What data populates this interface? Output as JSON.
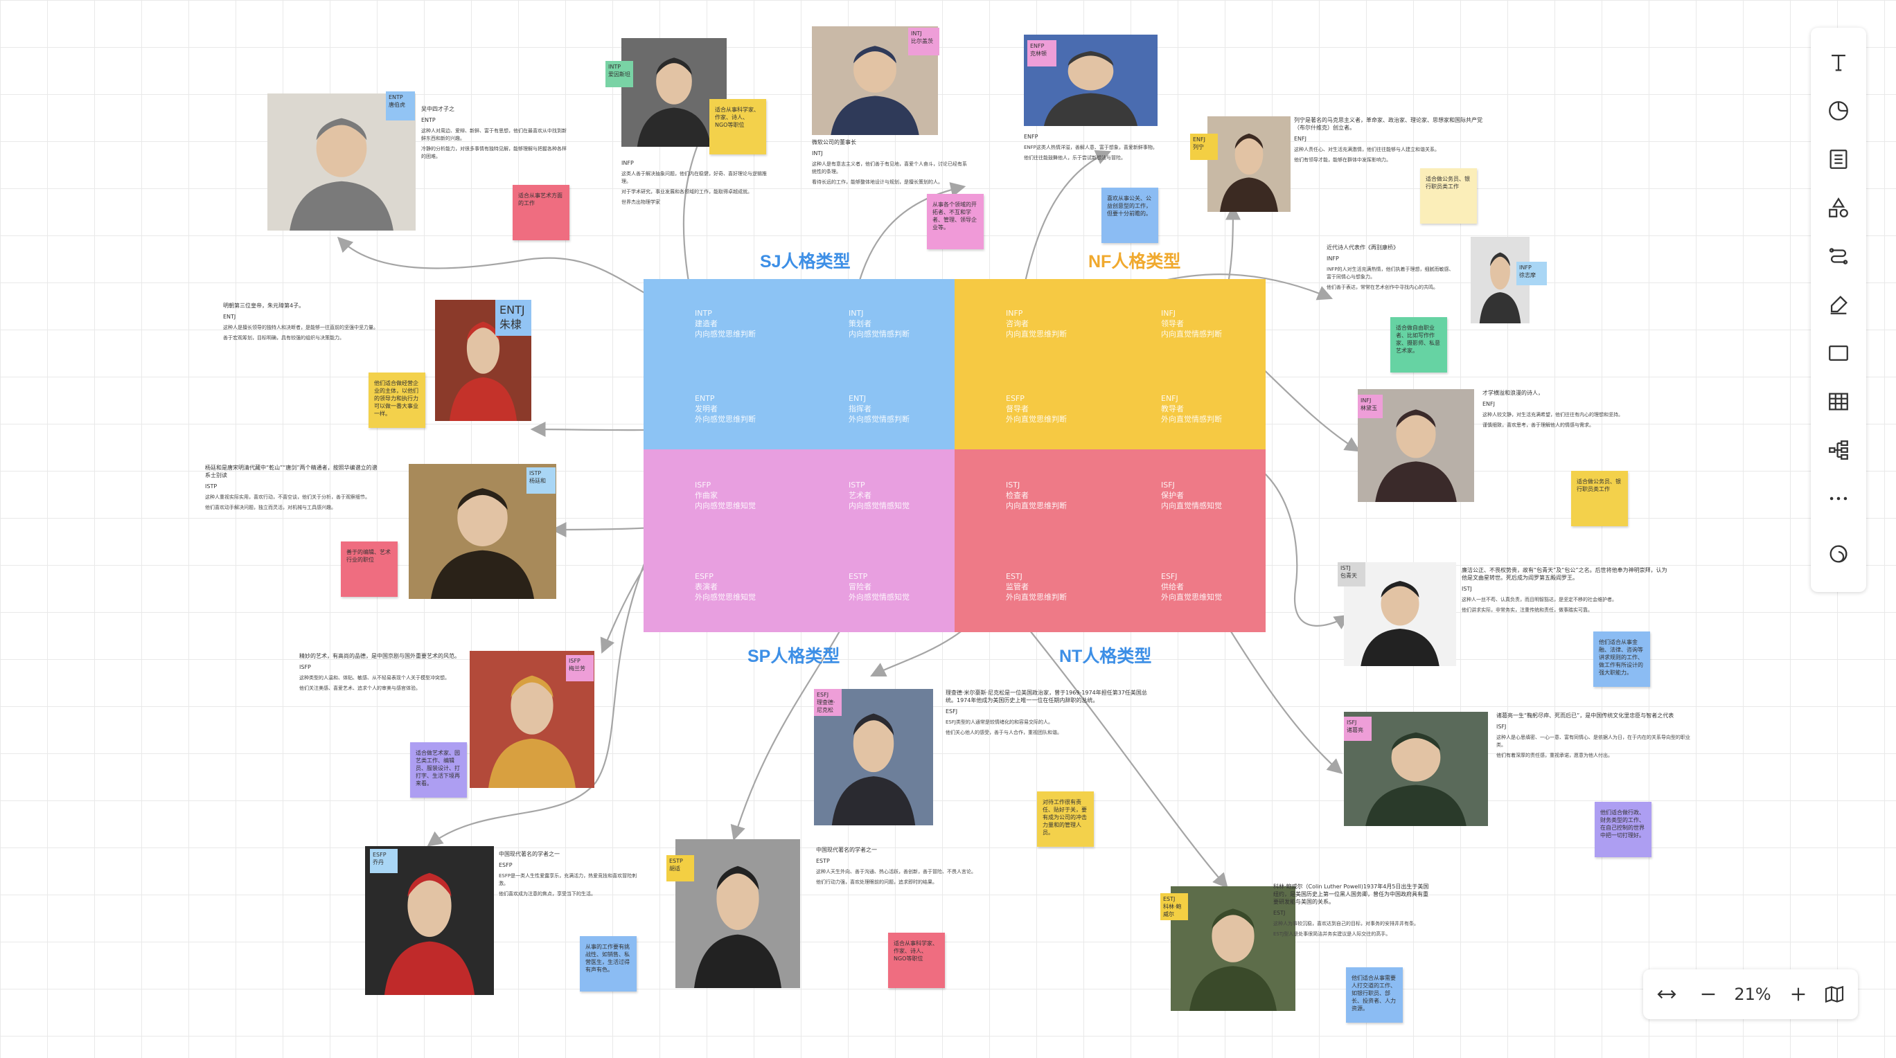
{
  "quadrant_titles": {
    "sj": "SJ人格类型",
    "nf": "NF人格类型",
    "sp": "SP人格类型",
    "nt": "NT人格类型"
  },
  "title_colors": {
    "sj": "#3d8fe6",
    "nf": "#f0a92e",
    "sp": "#3d8fe6",
    "nt": "#3d8fe6"
  },
  "quadrant_colors": {
    "sj": "#8cc3f4",
    "nf": "#f6c943",
    "sp": "#e89fe0",
    "nt": "#ee7a87"
  },
  "grid_cells": [
    {
      "code": "INTP",
      "name": "建造者",
      "desc": "内向感觉思维判断"
    },
    {
      "code": "INTJ",
      "name": "策划者",
      "desc": "内向感觉情感判断"
    },
    {
      "code": "INFP",
      "name": "咨询者",
      "desc": "内向直觉思维判断"
    },
    {
      "code": "INFJ",
      "name": "领导者",
      "desc": "内向直觉情感判断"
    },
    {
      "code": "ENTP",
      "name": "发明者",
      "desc": "外向感觉思维判断"
    },
    {
      "code": "ENTJ",
      "name": "指挥者",
      "desc": "外向感觉情感判断"
    },
    {
      "code": "ESFP",
      "name": "督导者",
      "desc": "外向直觉思维判断"
    },
    {
      "code": "ENFJ",
      "name": "教导者",
      "desc": "外向直觉情感判断"
    },
    {
      "code": "ISFP",
      "name": "作曲家",
      "desc": "内向感觉思维知觉"
    },
    {
      "code": "ISTP",
      "name": "艺术者",
      "desc": "内向感觉情感知觉"
    },
    {
      "code": "ISTJ",
      "name": "检查者",
      "desc": "内向直觉思维判断"
    },
    {
      "code": "ISFJ",
      "name": "保护者",
      "desc": "内向直觉情感知觉"
    },
    {
      "code": "ESFP",
      "name": "表演者",
      "desc": "外向感觉思维知觉"
    },
    {
      "code": "ESTP",
      "name": "冒险者",
      "desc": "外向感觉情感知觉"
    },
    {
      "code": "ESTJ",
      "name": "监管者",
      "desc": "外向直觉思维判断"
    },
    {
      "code": "ESFJ",
      "name": "供给者",
      "desc": "外向直觉思维知觉"
    }
  ],
  "cards": [
    {
      "id": "entp",
      "tag": "ENTP\n唐伯虎",
      "heading": "吴中四才子之",
      "type": "ENTP",
      "lines": [
        "这种人对周边、爱辩、新鲜、富于有思想，他们在最喜欢从中找到新鲜东西和新的兴趣。",
        "冷静的分析能力，对很多事情有独特见解，能够理解与把握各种各样的困难。"
      ],
      "sticky": "适合从事艺术方面的工作"
    },
    {
      "id": "intp",
      "tag": "INTP\n爱因斯坦",
      "heading": "",
      "type": "INFP",
      "lines": [
        "这类人善于解决抽象问题，他们内在稳健，好奇、喜好理论与逻辑推理。",
        "对于学术研究，事业发展和各领域的工作，能取得卓越成就。"
      ],
      "footer": "世界杰出物理学家",
      "sticky": "适合从事科学家、作家、诗人、NGO等职位"
    },
    {
      "id": "intj",
      "tag": "INTJ\n比尔盖茨",
      "heading": "微软公司的董事长",
      "type": "INTJ",
      "lines": [
        "这种人是有意志主义者，他们善于有见地，喜爱个人奋斗，讨论已经有系统性的条理。",
        "看待长远的工作，能够整体地设计与规划，是擅长策划的人。"
      ],
      "sticky": "从事各个领域的开拓者、不互和学者、管理、领导企业等。"
    },
    {
      "id": "enfp",
      "tag": "ENFP\n克林顿",
      "heading": "",
      "type": "ENFP",
      "lines": [
        "ENFP这类人热情洋溢，善解人意、富于想象，喜爱新鲜事物。",
        "他们往往能鼓舞他人，乐于尝试新想法与冒险。"
      ],
      "sticky": "喜欢从事公关、公益创意型的工作，但要十分前瞻的。"
    },
    {
      "id": "enfj",
      "tag": "ENFJ\n列宁",
      "heading": "列宁是著名的马克思主义者，革命家、政治家、理论家、思想家和国际共产党（布尔什维克）创立者。",
      "type": "ENFJ",
      "lines": [
        "这种人责任心、对生活充满激情，他们往往能够与人建立和谐关系。",
        "他们有领导才能，能够在群体中发挥影响力。"
      ],
      "sticky": "适合做公务员、银行职员类工作"
    },
    {
      "id": "infp",
      "tag": "INFP\n徐志摩",
      "heading": "近代诗人代表作《再别康桥》",
      "type": "INFP",
      "lines": [
        "INFP的人对生活充满热情，他们执着于理想，细腻而敏感、富于同情心与想象力。",
        "他们善于表达，常常在艺术创作中寻找内心的共鸣。"
      ],
      "sticky": "适合做自由职业者、比如写作作家、摄影师、私意艺术家。"
    },
    {
      "id": "entj",
      "tag": "ENTJ\n朱棣",
      "heading": "明朝第三位皇帝，朱元璋第4子。",
      "type": "ENTJ",
      "lines": [
        "这种人是擅长领导的独特人和决断者，是能够一往直前的坚强中坚力量。",
        "善于宏观筹划，目标明确，具有较强的组织与决策能力。"
      ],
      "sticky": "他们适合做经营企业的主体，以他们的领导力和执行力可以做一番大事业一样。"
    },
    {
      "id": "infj",
      "tag": "INFJ\n林黛玉",
      "heading": "才学横溢和浪漫的诗人，",
      "type": "ENFJ",
      "lines": [
        "这种人较文静，对生活充满希望，他们往往有内心的理想和坚持。",
        "谨慎细致，喜欢思考，善于理解他人的情感与需求。"
      ],
      "sticky": "适合做公务员、银行职员类工作"
    },
    {
      "id": "istp",
      "tag": "ISTP\n杨廷和",
      "heading": "杨廷和是唐宋明清代藏中“乾山”“唐剑”两个精通者，按照华编谱立的谱系士别读",
      "type": "ISTP",
      "lines": [
        "这种人重视实际实用，喜欢行动，不喜空谈，他们关于分析，善于观察细节。",
        "他们喜欢动手解决问题，独立而灵活，对机械与工具感兴趣。"
      ],
      "sticky": "善于的编辑、艺术行业的职位"
    },
    {
      "id": "istj",
      "tag": "ISTJ\n包青天",
      "heading": "廉洁公正、不畏权势贵，故有“包青天”及“包公”之名。后世将他奉为神明崇拜，认为他是文曲星转世。死后成为阎罗第五殿阎罗王。",
      "type": "ISTJ",
      "lines": [
        "这种人一丝不苟、认真负责，而且明智豁达，是坚定不移的社会维护者。",
        "他们讲求实际，非常务实，注重传统和责任，做事踏实可靠。"
      ],
      "sticky": "他们适合从事金融、法律、咨询等讲求规则的工作、做工作有所设计的强大职能力。"
    },
    {
      "id": "isfp",
      "tag": "ISFP\n梅兰芳",
      "heading": "精妙的艺术，有高尚的品德，是中国京剧与国外重要艺术的风范。",
      "type": "ISFP",
      "lines": [
        "这种类型的人温和、体贴、敏感、从不轻易表现个人关于模型冲突想。",
        "他们关注美感、喜爱艺术、追求个人的审美与感官体验。"
      ],
      "sticky": "适合做艺术家、园艺类工作、编辑员、服装设计、打打字、生活下境再来看。"
    },
    {
      "id": "esfj",
      "tag": "ESFJ\n理查德·尼克松",
      "heading": "理查德·米尔豪斯·尼克松是一位美国政治家，曾于1969-1974年担任第37任美国总统。1974年他成为美国历史上唯一一位在任期内辞职的总统。",
      "type": "ESFJ",
      "lines": [
        "ESFJ类型的人通常是较情绪化的和容易交际的人。",
        "他们关心他人的感受，善于与人合作，重视团队和谐。"
      ],
      "sticky": "对待工作很有责任、贴好于关，要有成为公司的冲击力量和的管理人员。"
    },
    {
      "id": "isfj",
      "tag": "ISFJ\n诸葛亮",
      "heading": "诸葛亮一生“鞠躬尽瘁、死而后已”，是中国传统文化里忠臣与智者之代表",
      "type": "ISFJ",
      "lines": [
        "这种人是心思缜密、一心一意、富有同情心、是依据人为日，在于内在的关系导向型的职业类。",
        "他们有着深厚的责任感，重视承诺，愿意为他人付出。"
      ],
      "sticky": "他们适合做行政、财务类型的工作、在自己控制的世界中把一切打理好。"
    },
    {
      "id": "esfp",
      "tag": "ESFP\n乔丹",
      "heading": "中国现代著名的学者之一",
      "type": "ESFP",
      "lines": [
        "ESFP是一类人生性爱露享乐，充满活力，热爱竞技和喜欢冒险刺激。",
        "他们喜欢成为注意的焦点，享受当下的生活。"
      ],
      "sticky": "从事的工作要有挑战性、如销售、私营医生，生活过得有声有色。"
    },
    {
      "id": "estp",
      "tag": "ESTP\n胡适",
      "heading": "中国现代著名的学者之一",
      "type": "ESTP",
      "lines": [
        "这种人天生外向、善于沟通、热心活跃，善创新，善于冒险、不畏人言论。",
        "他们行动力强，喜欢处理眼前的问题，追求即时的结果。"
      ],
      "sticky": "适合从事科学家、作家、诗人、NGO等职位"
    },
    {
      "id": "estj",
      "tag": "ESTJ\n科林·鲍威尔",
      "heading": "科林·鲍威尔（Colin Luther Powell)1937年4月5日出生于美国纽约，是美国历史上第一位黑人国务卿，曾任为中国政府具有重要研发能与美国的关系。",
      "type": "ESTJ",
      "lines": [
        "这种人为事较沉稳，喜欢达到自己的目标，对事务的安排井井有条。",
        "ESTJ型人是处事很简洁并务实建议是人际交往的高手。"
      ],
      "sticky": "他们适合从事需要人打交道的工作、如银行职员、部长、投资者、人力资源。"
    }
  ],
  "toolbar": [
    "text-tool",
    "shape-tool",
    "note-tool",
    "template-tool",
    "connector-tool",
    "pen-tool",
    "frame-tool",
    "table-tool",
    "mindmap-tool",
    "more-tool",
    "undo-tool"
  ],
  "zoom": {
    "level": "21%"
  }
}
